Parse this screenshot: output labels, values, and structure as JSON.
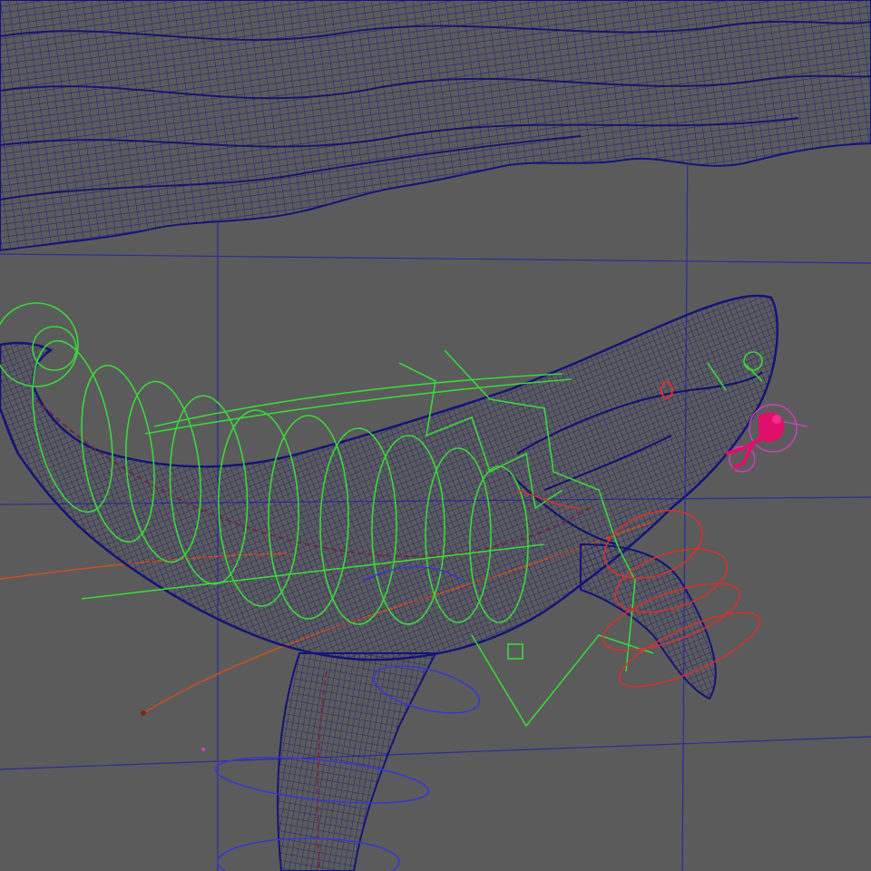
{
  "viewport": {
    "background": "#5b5b5b",
    "grid_color": "#2c2c9a",
    "mesh_color": "#1c1c88",
    "rig_colors": {
      "spine_controls": "#39d839",
      "fin_controls_right": "#d83030",
      "fin_controls_bottom": "#3838d0",
      "curve": "#c85020",
      "diver": "#e0106a",
      "diver_controls": "#d040c0"
    }
  },
  "objects": [
    {
      "name": "ocean-surface-mesh",
      "kind": "wireframe"
    },
    {
      "name": "whale-mesh",
      "kind": "wireframe"
    },
    {
      "name": "whale-rig-spine",
      "kind": "nurbs-controls"
    },
    {
      "name": "pectoral-fin-controls",
      "kind": "nurbs-controls"
    },
    {
      "name": "lower-fin-controls",
      "kind": "nurbs-controls"
    },
    {
      "name": "diver-model",
      "kind": "character"
    }
  ]
}
